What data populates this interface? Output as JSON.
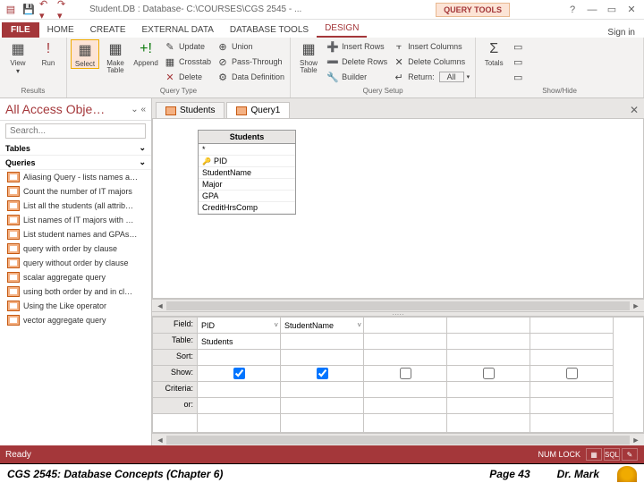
{
  "titlebar": {
    "title": "Student.DB : Database- C:\\COURSES\\CGS 2545 - ...",
    "context": "QUERY TOOLS"
  },
  "ribbon_tabs": {
    "file": "FILE",
    "items": [
      "HOME",
      "CREATE",
      "EXTERNAL DATA",
      "DATABASE TOOLS",
      "DESIGN"
    ],
    "active_index": 4,
    "signin": "Sign in"
  },
  "ribbon": {
    "results": {
      "label": "Results",
      "view": "View",
      "run": "Run"
    },
    "query_type": {
      "label": "Query Type",
      "select": "Select",
      "make": "Make\nTable",
      "append": "Append",
      "update": "Update",
      "crosstab": "Crosstab",
      "delete": "Delete",
      "union": "Union",
      "passthrough": "Pass-Through",
      "datadef": "Data Definition"
    },
    "query_setup": {
      "label": "Query Setup",
      "show_table": "Show\nTable",
      "insert_rows": "Insert Rows",
      "delete_rows": "Delete Rows",
      "builder": "Builder",
      "insert_cols": "Insert Columns",
      "delete_cols": "Delete Columns",
      "return": "Return:",
      "return_val": "All"
    },
    "showhide": {
      "label": "Show/Hide",
      "totals": "Totals"
    }
  },
  "nav": {
    "header": "All Access Obje…",
    "search_ph": "Search...",
    "tables": "Tables",
    "queries": "Queries",
    "items": [
      "Aliasing Query - lists names a…",
      "Count the number of IT majors",
      "List all the students (all attrib…",
      "List names of IT majors with …",
      "List student names and GPAs…",
      "query with order by clause",
      "query without order by clause",
      "scalar aggregate query",
      "using both order by and in cl…",
      "Using the Like operator",
      "vector aggregate query"
    ]
  },
  "doc_tabs": {
    "items": [
      "Students",
      "Query1"
    ],
    "active_index": 1
  },
  "table_box": {
    "name": "Students",
    "star": "*",
    "fields": [
      "PID",
      "StudentName",
      "Major",
      "GPA",
      "CreditHrsComp"
    ]
  },
  "grid": {
    "labels": [
      "Field:",
      "Table:",
      "Sort:",
      "Show:",
      "Criteria:",
      "or:"
    ],
    "cols": [
      {
        "field": "PID",
        "table": "Students",
        "show": true
      },
      {
        "field": "StudentName",
        "table": "",
        "show": true
      },
      {
        "field": "",
        "table": "",
        "show": false
      },
      {
        "field": "",
        "table": "",
        "show": false
      },
      {
        "field": "",
        "table": "",
        "show": false
      }
    ]
  },
  "statusbar": {
    "ready": "Ready",
    "numlock": "NUM LOCK",
    "sql": "SQL"
  },
  "footer": {
    "course": "CGS 2545: Database Concepts  (Chapter 6)",
    "page": "Page 43",
    "author": "Dr. Mark"
  }
}
